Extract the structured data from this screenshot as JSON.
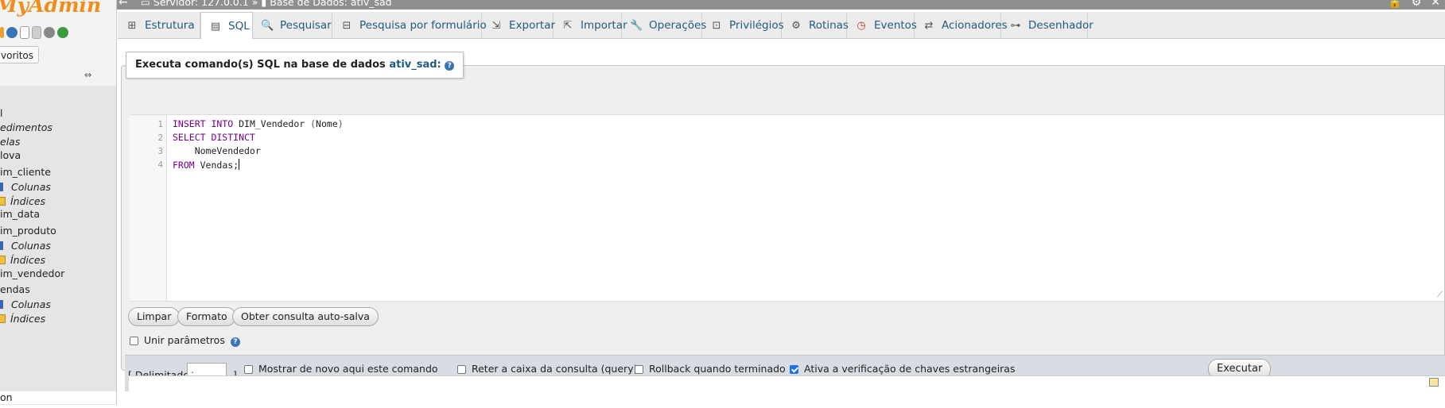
{
  "logo_text": "MyAdmin",
  "nav": {
    "favorites_label": "voritos",
    "link_icon": "⇔",
    "items": [
      {
        "label": "l",
        "italic": false
      },
      {
        "label": "edimentos",
        "italic": true
      },
      {
        "label": "elas",
        "italic": true
      },
      {
        "label": "lova",
        "italic": false
      },
      {
        "label": "im_cliente",
        "italic": false
      },
      {
        "label": "Colunas",
        "italic": true
      },
      {
        "label": "Índices",
        "italic": true
      },
      {
        "label": "im_data",
        "italic": false
      },
      {
        "label": "im_produto",
        "italic": false
      },
      {
        "label": "Colunas",
        "italic": true
      },
      {
        "label": "Índices",
        "italic": true
      },
      {
        "label": "im_vendedor",
        "italic": false
      },
      {
        "label": "endas",
        "italic": false
      },
      {
        "label": "Colunas",
        "italic": true
      },
      {
        "label": "Índices",
        "italic": true
      },
      {
        "label": "on",
        "italic": false
      }
    ]
  },
  "topbar": {
    "back_icon": "←",
    "server_label": "Servidor: 127.0.0.1 »",
    "db_label": "Base de Dados: ativ_sad",
    "icon_lock": "🔒",
    "icon_gear": "⚙",
    "icon_close": "✕"
  },
  "tabs": [
    {
      "label": "Estrutura",
      "icon": "⊞"
    },
    {
      "label": "SQL",
      "icon": "▤"
    },
    {
      "label": "Pesquisar",
      "icon": "🔍"
    },
    {
      "label": "Pesquisa por formulário",
      "icon": "⊟"
    },
    {
      "label": "Exportar",
      "icon": "⇲"
    },
    {
      "label": "Importar",
      "icon": "⇱"
    },
    {
      "label": "Operações",
      "icon": "🔧"
    },
    {
      "label": "Privilégios",
      "icon": "⊡"
    },
    {
      "label": "Rotinas",
      "icon": "⚙"
    },
    {
      "label": "Eventos",
      "icon": "◷"
    },
    {
      "label": "Acionadores",
      "icon": "⇄"
    },
    {
      "label": "Desenhador",
      "icon": "⊶"
    }
  ],
  "sql_panel": {
    "legend_prefix": "Executa comando(s) SQL na base de dados",
    "db_name": "ativ_sad:",
    "help_icon": "?",
    "editor": {
      "line_numbers": [
        "1",
        "2",
        "3",
        "4"
      ],
      "lines": [
        [
          {
            "t": "INSERT INTO",
            "c": "kw"
          },
          {
            "t": " DIM_Vendedor ",
            "c": ""
          },
          {
            "t": "(",
            "c": "pn"
          },
          {
            "t": "Nome",
            "c": ""
          },
          {
            "t": ")",
            "c": "pn"
          }
        ],
        [
          {
            "t": "SELECT DISTINCT",
            "c": "kw"
          }
        ],
        [
          {
            "t": "    NomeVendedor",
            "c": ""
          }
        ],
        [
          {
            "t": "FROM",
            "c": "kw"
          },
          {
            "t": " Vendas;",
            "c": ""
          }
        ]
      ],
      "resize_icon": "⟋"
    },
    "buttons": {
      "clear": "Limpar",
      "format": "Formato",
      "autosave": "Obter consulta auto-salva"
    },
    "bind_params_label": "Unir parâmetros"
  },
  "options": {
    "delimiter_open": "[ Delimitador",
    "delimiter_value": ";",
    "delimiter_close": "]",
    "show_again_label": "Mostrar de novo aqui este comando",
    "show_again_checked": false,
    "retain_label": "Reter a caixa da consulta (query)",
    "retain_checked": false,
    "rollback_label": "Rollback quando terminado",
    "rollback_checked": false,
    "fk_label": "Ativa a verificação de chaves estrangeiras",
    "fk_checked": true,
    "execute_label": "Executar"
  }
}
